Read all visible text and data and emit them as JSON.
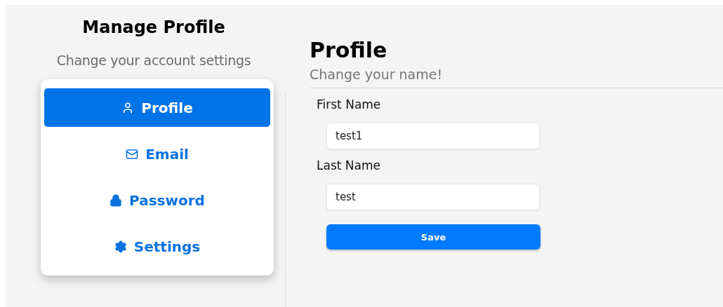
{
  "sidebar": {
    "title": "Manage Profile",
    "subtitle": "Change your account settings",
    "items": [
      {
        "label": "Profile",
        "kind": "user",
        "selected": true
      },
      {
        "label": "Email",
        "kind": "mail",
        "selected": false
      },
      {
        "label": "Password",
        "kind": "lock",
        "selected": false
      },
      {
        "label": "Settings",
        "kind": "gear",
        "selected": false
      }
    ]
  },
  "main": {
    "title": "Profile",
    "subtitle": "Change your name!",
    "fields": [
      {
        "label": "First Name",
        "value": "test1"
      },
      {
        "label": "Last Name",
        "value": "test"
      }
    ],
    "button": "Save"
  }
}
